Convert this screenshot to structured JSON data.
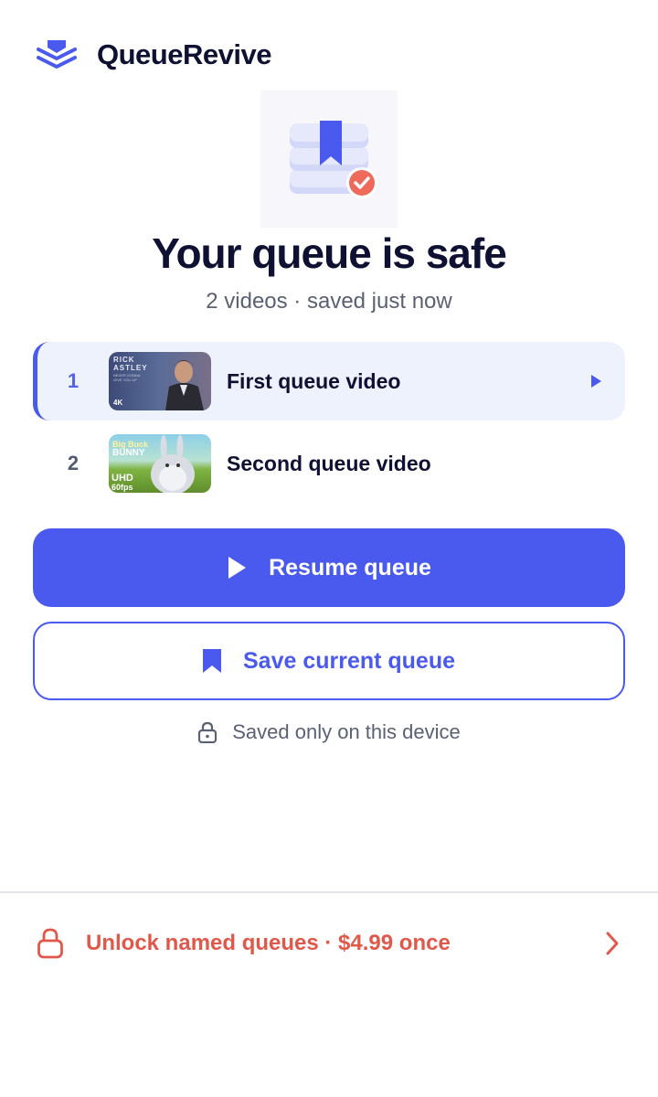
{
  "app": {
    "title": "QueueRevive"
  },
  "hero": {
    "title": "Your queue is safe",
    "subtitle": "2 videos · saved just now"
  },
  "queue": {
    "items": [
      {
        "number": "1",
        "title": "First queue video",
        "thumbnail_text": [
          "RICK",
          "ASTLEY",
          "NEVER GONNA",
          "GIVE YOU UP",
          "4K"
        ],
        "active": true
      },
      {
        "number": "2",
        "title": "Second queue video",
        "thumbnail_text": [
          "Big Buck",
          "BUNNY",
          "UHD",
          "60fps"
        ],
        "active": false
      }
    ]
  },
  "actions": {
    "resume_label": "Resume queue",
    "save_label": "Save current queue",
    "device_note": "Saved only on this device"
  },
  "upsell": {
    "label": "Unlock named queues · $4.99 once"
  },
  "colors": {
    "accent": "#4a59ee",
    "upsell": "#e0584a",
    "active_row_bg": "#eef2fd"
  },
  "icons": [
    "layers-logo-icon",
    "saved-archive-icon",
    "play-icon",
    "bookmark-icon",
    "lock-icon",
    "chevron-right-icon"
  ]
}
